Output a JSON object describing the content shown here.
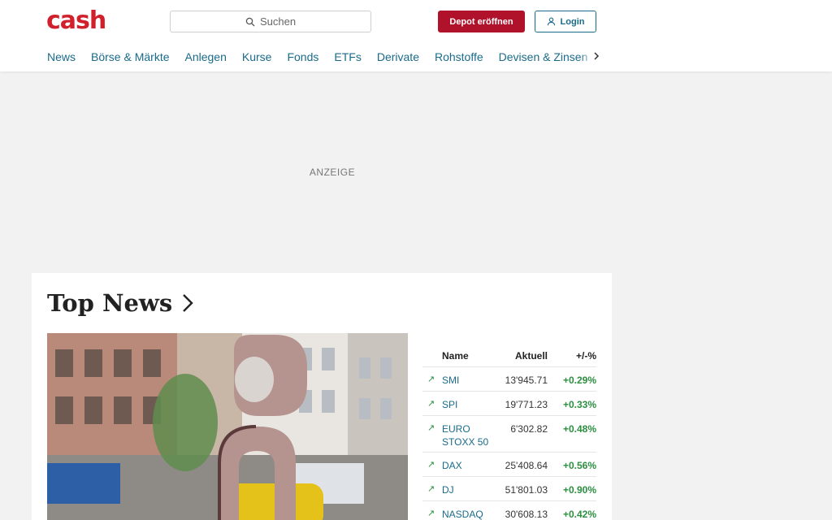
{
  "header": {
    "logo": "cash",
    "search_placeholder": "Suchen",
    "depot_button": "Depot eröffnen",
    "login_button": "Login"
  },
  "nav": {
    "items": [
      "News",
      "Börse & Märkte",
      "Anlegen",
      "Kurse",
      "Fonds",
      "ETFs",
      "Derivate",
      "Rohstoffe",
      "Devisen & Zinsen"
    ]
  },
  "ad": {
    "label": "ANZEIGE"
  },
  "top_news": {
    "title": "Top News"
  },
  "market_table": {
    "headers": {
      "name": "Name",
      "value": "Aktuell",
      "change": "+/-%"
    },
    "rows": [
      {
        "name": "SMI",
        "value": "13'945.71",
        "change": "+0.29%"
      },
      {
        "name": "SPI",
        "value": "19'771.23",
        "change": "+0.33%"
      },
      {
        "name": "EURO STOXX 50",
        "value": "6'302.82",
        "change": "+0.48%"
      },
      {
        "name": "DAX",
        "value": "25'408.64",
        "change": "+0.56%"
      },
      {
        "name": "DJ",
        "value": "51'801.03",
        "change": "+0.90%"
      },
      {
        "name": "NASDAQ",
        "value": "30'608.13",
        "change": "+0.42%"
      }
    ]
  },
  "colors": {
    "brand_red": "#d0202b",
    "link_blue": "#1a6b8a",
    "positive_green": "#2a8f3f"
  }
}
